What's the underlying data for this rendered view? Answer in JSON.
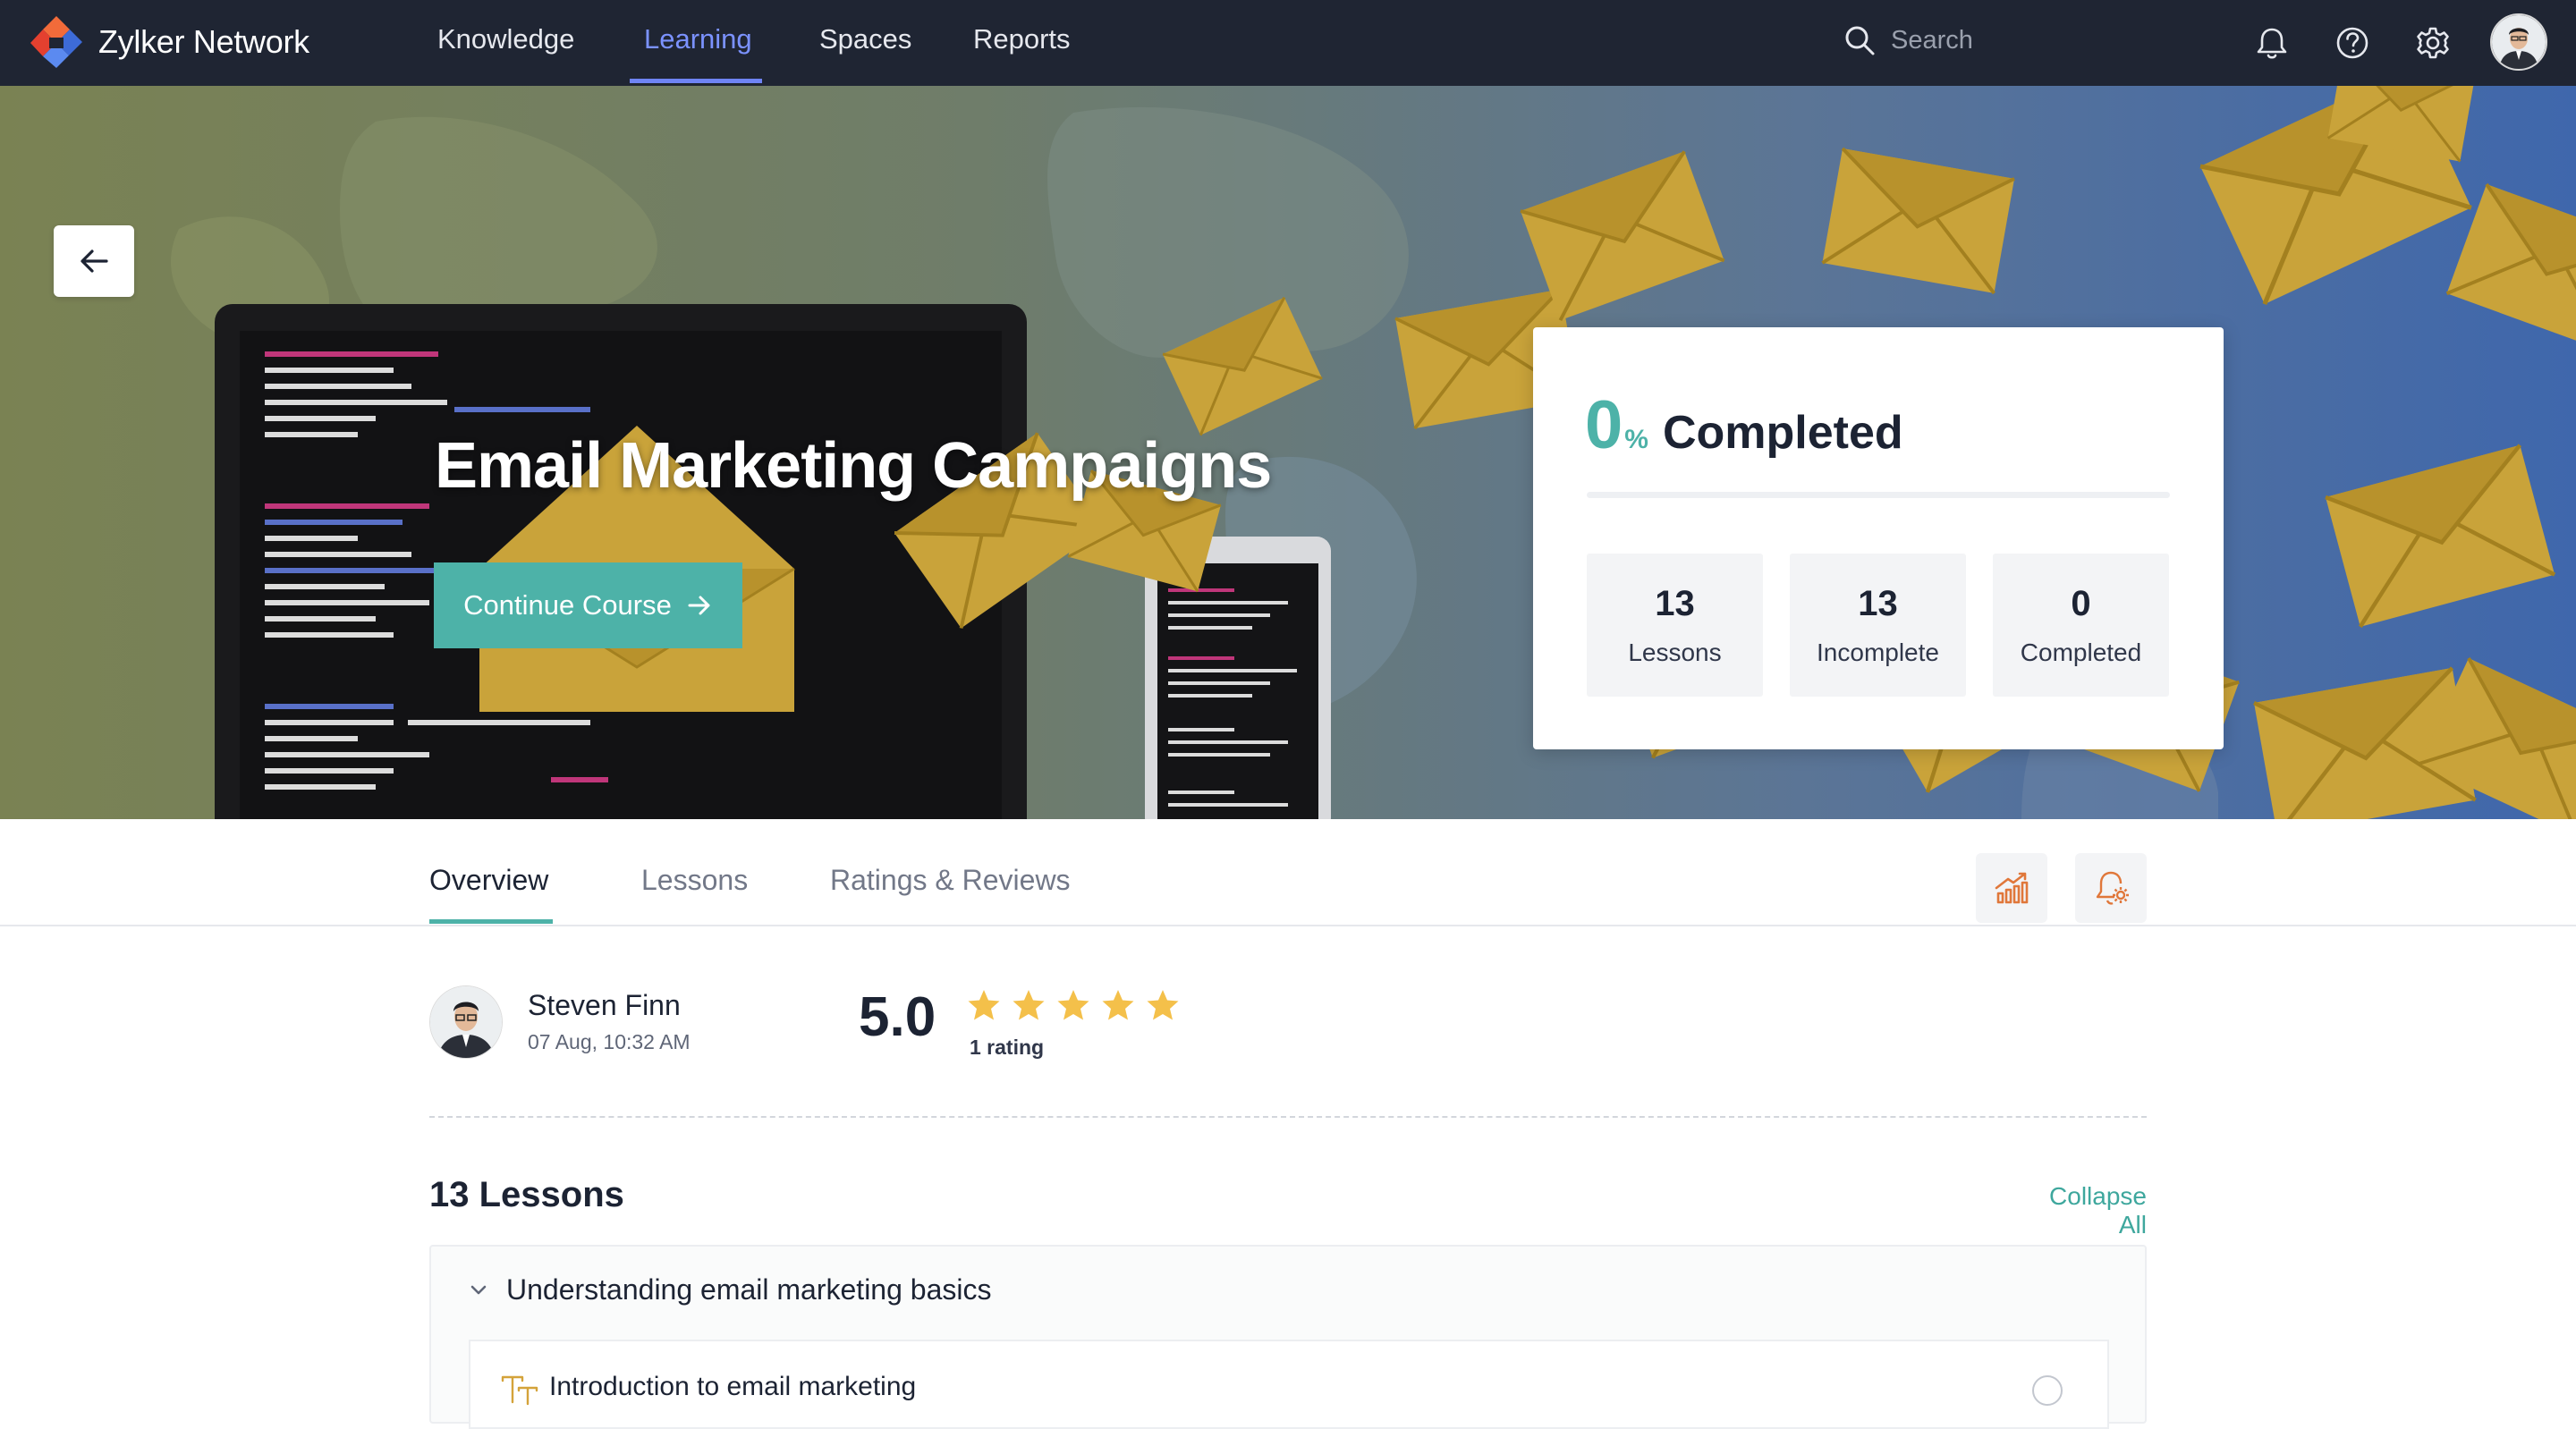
{
  "app": {
    "name": "Zylker Network"
  },
  "nav": {
    "items": [
      {
        "label": "Knowledge"
      },
      {
        "label": "Learning",
        "active": true
      },
      {
        "label": "Spaces"
      },
      {
        "label": "Reports"
      }
    ],
    "search_placeholder": "Search"
  },
  "top_icons": [
    "bell-icon",
    "help-icon",
    "gear-icon"
  ],
  "course": {
    "title": "Email Marketing Campaigns",
    "continue_label": "Continue Course"
  },
  "progress": {
    "percent": "0",
    "percent_sign": "%",
    "label": "Completed",
    "fraction": 0,
    "stats": [
      {
        "value": "13",
        "label": "Lessons"
      },
      {
        "value": "13",
        "label": "Incomplete"
      },
      {
        "value": "0",
        "label": "Completed"
      }
    ]
  },
  "tabs": [
    {
      "label": "Overview",
      "active": true
    },
    {
      "label": "Lessons"
    },
    {
      "label": "Ratings & Reviews"
    }
  ],
  "tools": [
    "analytics-icon",
    "course-settings-icon"
  ],
  "author": {
    "name": "Steven Finn",
    "date": "07 Aug, 10:32 AM"
  },
  "rating": {
    "value": "5.0",
    "stars": 5,
    "max_stars": 5,
    "count_label": "1 rating"
  },
  "lessons": {
    "title": "13 Lessons",
    "collapse_label": "Collapse All",
    "sections": [
      {
        "title": "Understanding email marketing basics",
        "items": [
          {
            "title": "Introduction to email marketing"
          }
        ]
      }
    ]
  },
  "colors": {
    "nav_bg": "#1f2533",
    "accent": "#4db2a8",
    "nav_active": "#7b92ff",
    "star": "#f4c04a",
    "logo_orange": "#f26b3a",
    "logo_blue": "#3d6bd8"
  }
}
